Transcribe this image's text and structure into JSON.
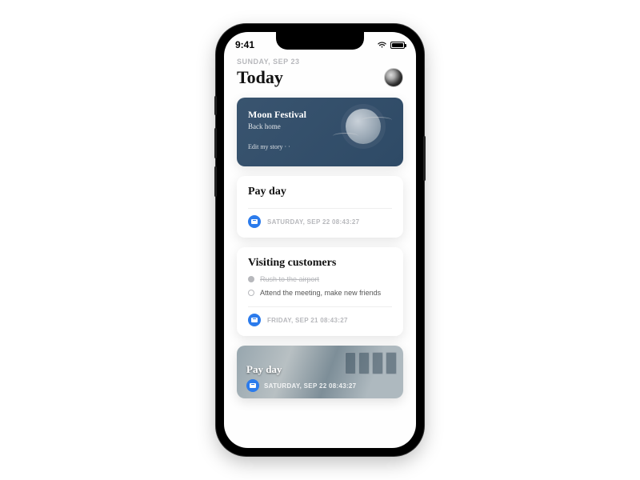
{
  "status": {
    "time": "9:41"
  },
  "header": {
    "date_line": "SUNDAY,  SEP 23",
    "title": "Today"
  },
  "featured": {
    "title": "Moon Festival",
    "subtitle": "Back home",
    "action": "Edit my story · ·"
  },
  "cards": [
    {
      "title": "Pay day",
      "footer": "SATURDAY,  SEP 22   08:43:27"
    },
    {
      "title": "Visiting customers",
      "tasks": [
        {
          "text": "Rush to the airport",
          "done": true
        },
        {
          "text": "Attend the meeting, make new friends",
          "done": false
        }
      ],
      "footer": "FRIDAY,  SEP 21   08:43:27"
    }
  ],
  "image_card": {
    "title": "Pay day",
    "footer": "SATURDAY,  SEP 22   08:43:27"
  }
}
